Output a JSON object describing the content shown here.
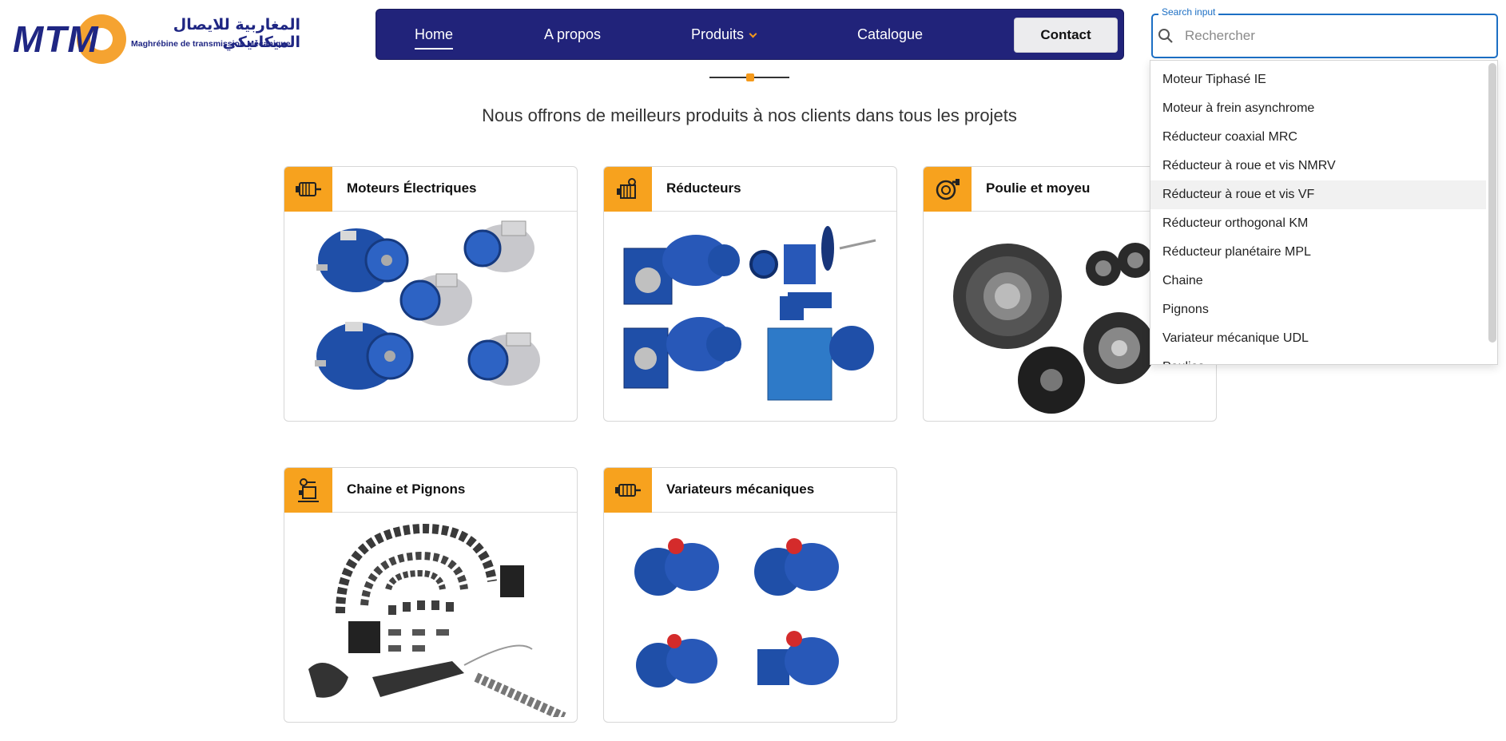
{
  "logo": {
    "mtm": "MTM",
    "arabic": "المغاربية للايصال الميكانيكي",
    "subtitle": "Maghrébine de transmission Mécanique"
  },
  "nav": {
    "items": [
      {
        "label": "Home",
        "active": true
      },
      {
        "label": "A propos"
      },
      {
        "label": "Produits",
        "has_dropdown": true
      },
      {
        "label": "Catalogue"
      }
    ],
    "contact_label": "Contact"
  },
  "tagline": "Nous offrons de meilleurs produits à nos clients dans tous les projets",
  "cards": [
    {
      "title": "Moteurs Électriques"
    },
    {
      "title": "Réducteurs"
    },
    {
      "title": "Poulie et moyeu"
    },
    {
      "title": "Chaine et Pignons"
    },
    {
      "title": "Variateurs mécaniques"
    }
  ],
  "search": {
    "label": "Search input",
    "placeholder": "Rechercher",
    "value": ""
  },
  "dropdown": {
    "items": [
      "Moteur Tiphasé IE",
      "Moteur à frein asynchrome",
      "Réducteur coaxial MRC",
      "Réducteur à roue et vis NMRV",
      "Réducteur à roue et vis VF",
      "Réducteur orthogonal KM",
      "Réducteur planétaire MPL",
      "Chaine",
      "Pignons",
      "Variateur mécanique UDL",
      "Poulies"
    ],
    "hovered_index": 4
  },
  "colors": {
    "nav_bg": "#21237a",
    "accent": "#f59a1b",
    "search_border": "#1c6fc4",
    "motor_blue": "#1f4fa8"
  }
}
